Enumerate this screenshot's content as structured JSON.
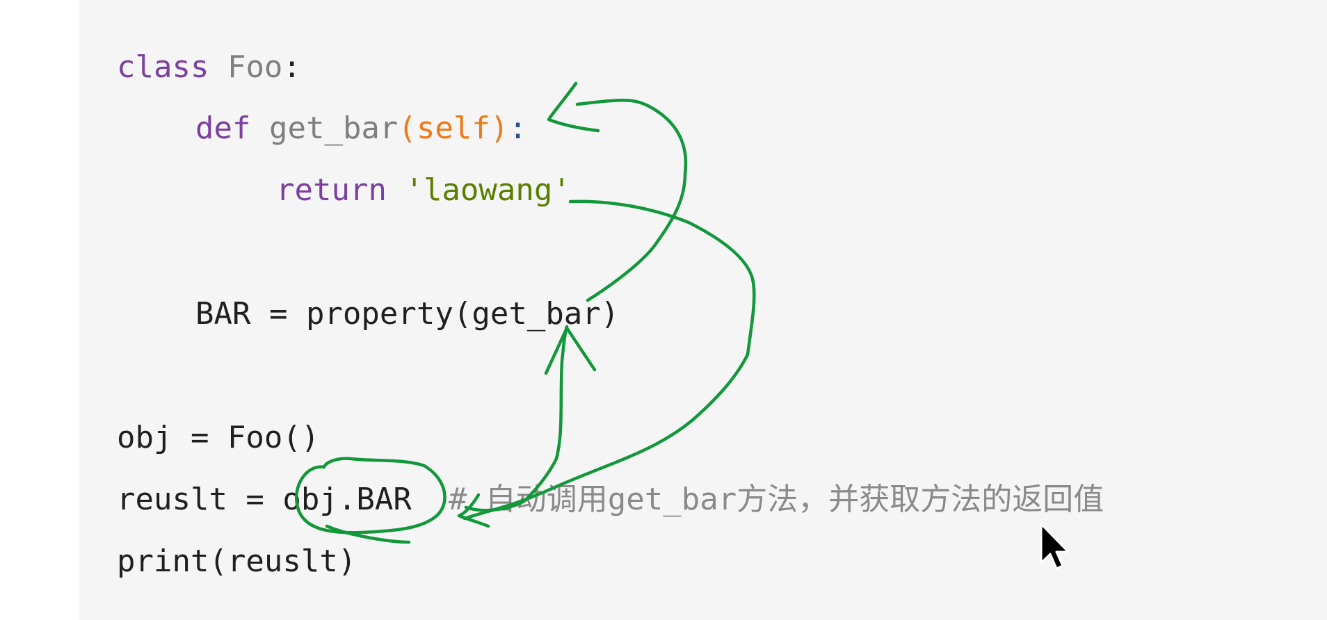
{
  "code": {
    "line1": {
      "keyword": "class",
      "name": "Foo",
      "colon": ":"
    },
    "line2": {
      "keyword": "def",
      "name": "get_bar",
      "params": "(self)",
      "colon": ":"
    },
    "line3": {
      "keyword": "return",
      "string": "'laowang'"
    },
    "line5": {
      "text": "BAR = property(get_bar)"
    },
    "line7": {
      "text": "obj = Foo()"
    },
    "line8": {
      "text": "reuslt = obj.BAR",
      "comment": "# 自动调用get_bar方法，并获取方法的返回值"
    },
    "line9": {
      "text": "print(reuslt)"
    }
  },
  "annotation_color": "#12973a",
  "icons": {
    "cursor": "mouse-pointer-icon"
  }
}
